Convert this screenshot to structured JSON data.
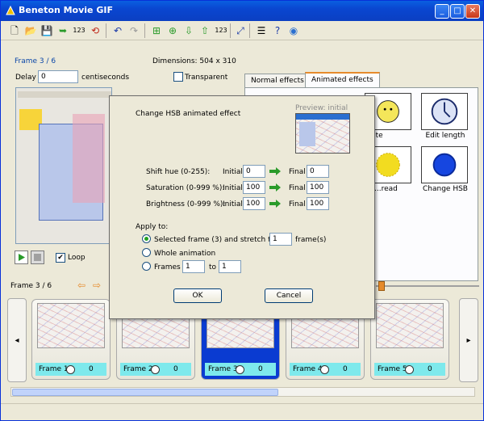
{
  "window": {
    "title": "Beneton Movie GIF"
  },
  "left_panel": {
    "frame_label": "Frame 3 / 6",
    "dimensions": "Dimensions: 504 x 310",
    "delay_label": "Delay",
    "delay_value": "0",
    "delay_unit": "centiseconds",
    "transparent_label": "Transparent",
    "loop_label": "Loop"
  },
  "tabs": [
    {
      "label": "Normal effects"
    },
    {
      "label": "Animated effects"
    }
  ],
  "effects": [
    {
      "label": "...tate",
      "icon": "rotate-icon"
    },
    {
      "label": "Edit length",
      "icon": "clock-icon"
    },
    {
      "label": "...read",
      "icon": "spread-icon"
    },
    {
      "label": "Change HSB",
      "icon": "hsb-icon"
    }
  ],
  "frame_bar": {
    "label": "Frame 3 / 6"
  },
  "frames": [
    {
      "label": "Frame 1",
      "delay": "0"
    },
    {
      "label": "Frame 2",
      "delay": "0"
    },
    {
      "label": "Frame 3",
      "delay": "0"
    },
    {
      "label": "Frame 4",
      "delay": "0"
    },
    {
      "label": "Frame 5",
      "delay": "0"
    }
  ],
  "dialog": {
    "title": "Change HSB animated effect",
    "preview_label": "Preview: initial",
    "hue_label": "Shift hue (0-255):",
    "sat_label": "Saturation (0-999 %):",
    "bri_label": "Brightness (0-999 %):",
    "initial_label": "Initial",
    "final_label": "Final",
    "hue_initial": "0",
    "hue_final": "0",
    "sat_initial": "100",
    "sat_final": "100",
    "bri_initial": "100",
    "bri_final": "100",
    "apply_label": "Apply to:",
    "opt_selected": "Selected frame (3) and stretch to",
    "stretch_value": "1",
    "stretch_unit": "frame(s)",
    "opt_whole": "Whole animation",
    "opt_frames": "Frames",
    "frames_from": "1",
    "frames_to_label": "to",
    "frames_to": "1",
    "ok_label": "OK",
    "cancel_label": "Cancel"
  },
  "colors": {
    "accent": "#0a46d0",
    "frame_label_bg": "#7ee9ec",
    "selected_frame": "#0a3bd1"
  }
}
